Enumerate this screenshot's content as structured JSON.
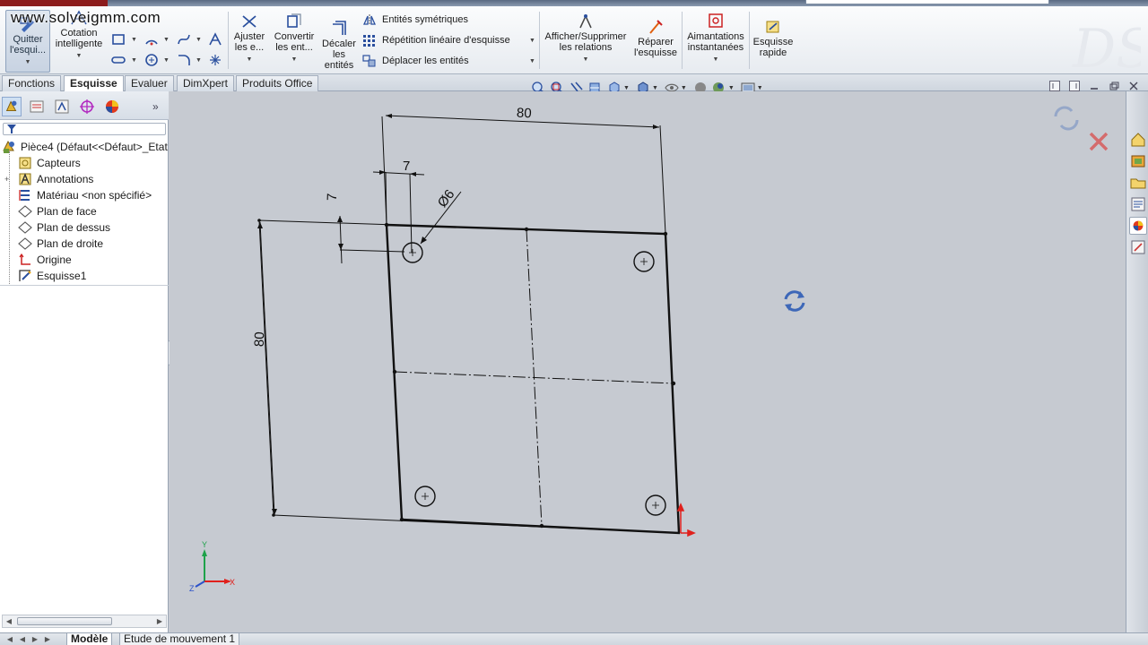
{
  "watermark": "www.solveigmm.com",
  "ribbon": {
    "quit": {
      "label1": "Quitter",
      "label2": "l'esqui...",
      "icon": "exit-sketch-icon"
    },
    "dimension": {
      "label1": "Cotation",
      "label2": "intelligente",
      "icon": "smart-dimension-icon"
    },
    "trim": {
      "label1": "Ajuster",
      "label2": "les e...",
      "icon": "trim-icon"
    },
    "convert": {
      "label1": "Convertir",
      "label2": "les ent...",
      "icon": "convert-entities-icon"
    },
    "offset": {
      "label1": "Décaler",
      "label2": "les",
      "label3": "entités",
      "icon": "offset-entities-icon"
    },
    "mirror": {
      "label": "Entités symétriques",
      "icon": "mirror-icon"
    },
    "pattern": {
      "label": "Répétition linéaire d'esquisse",
      "icon": "linear-pattern-icon"
    },
    "move": {
      "label": "Déplacer les entités",
      "icon": "move-entities-icon"
    },
    "relations": {
      "label1": "Afficher/Supprimer",
      "label2": "les relations",
      "icon": "relations-icon"
    },
    "repair": {
      "label1": "Réparer",
      "label2": "l'esquisse",
      "icon": "repair-sketch-icon"
    },
    "snaps": {
      "label1": "Aimantations",
      "label2": "instantanées",
      "icon": "snap-icon"
    },
    "rapid": {
      "label1": "Esquisse",
      "label2": "rapide",
      "icon": "rapid-sketch-icon"
    }
  },
  "tabs": [
    {
      "label": "Fonctions",
      "active": false
    },
    {
      "label": "Esquisse",
      "active": true
    },
    {
      "label": "Evaluer",
      "active": false
    },
    {
      "label": "DimXpert",
      "active": false
    },
    {
      "label": "Produits Office",
      "active": false
    }
  ],
  "tree": {
    "root": "Pièce4  (Défaut<<Défaut>_Etat",
    "items": [
      {
        "label": "Capteurs",
        "icon": "sensors-icon"
      },
      {
        "label": "Annotations",
        "icon": "annotations-icon"
      },
      {
        "label": "Matériau <non spécifié>",
        "icon": "material-icon"
      },
      {
        "label": "Plan de face",
        "icon": "plane-icon"
      },
      {
        "label": "Plan de dessus",
        "icon": "plane-icon"
      },
      {
        "label": "Plan de droite",
        "icon": "plane-icon"
      },
      {
        "label": "Origine",
        "icon": "origin-icon"
      },
      {
        "label": "Esquisse1",
        "icon": "sketch-icon"
      }
    ]
  },
  "sketch": {
    "dim_top": "80",
    "dim_left": "80",
    "dim_hole_x": "7",
    "dim_hole_y": "7",
    "dim_diameter": "Ø6",
    "triad_x": "X",
    "triad_y": "Y",
    "triad_z": "Z"
  },
  "bottom_tabs": [
    {
      "label": "Modèle",
      "active": true
    },
    {
      "label": "Etude de mouvement 1",
      "active": false
    }
  ],
  "colors": {
    "sketch_line": "#111111",
    "ribbon_accent": "#2a4f9e",
    "origin_red": "#e0201c",
    "triad_green": "#1ea24a",
    "triad_blue": "#2c52c9"
  }
}
